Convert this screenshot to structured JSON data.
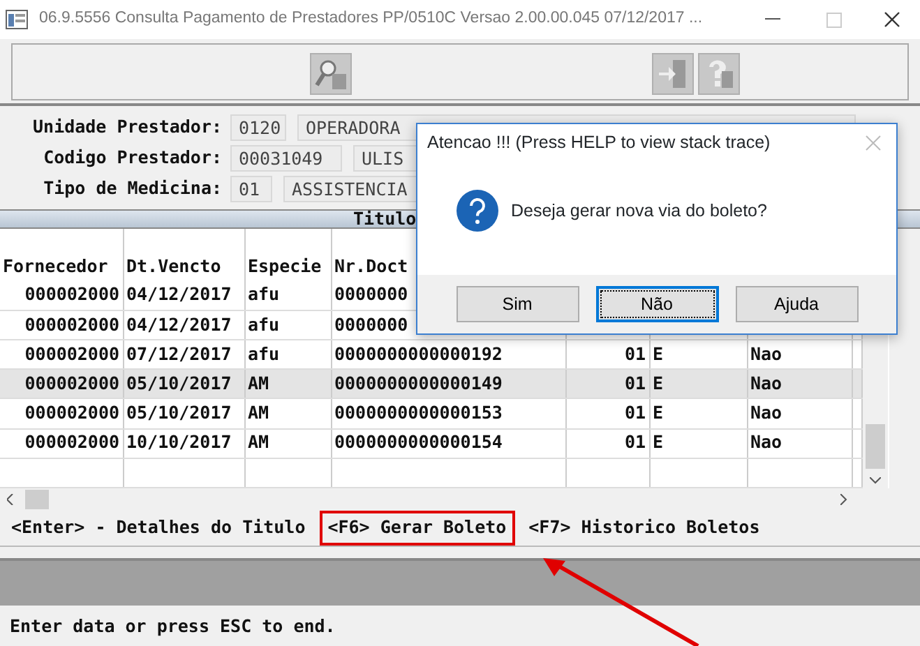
{
  "window": {
    "title": "06.9.5556  Consulta  Pagamento de Prestadores PP/0510C Versao 2.00.00.045 07/12/2017 ..."
  },
  "fields": [
    {
      "label": "Unidade Prestador:",
      "code": "0120",
      "value": "OPERADORA"
    },
    {
      "label": "Codigo Prestador:",
      "code": "00031049",
      "value": "ULIS"
    },
    {
      "label": "Tipo de Medicina:",
      "code": "01",
      "value": "ASSISTENCIA"
    }
  ],
  "table": {
    "title": "Titulo",
    "columns": [
      "Fornecedor",
      "Dt.Vencto",
      "Especie",
      "Nr.Doct"
    ],
    "rows": [
      {
        "selected": false,
        "cells": [
          "000002000",
          "04/12/2017",
          "afu",
          "0000000"
        ]
      },
      {
        "selected": false,
        "cells": [
          "000002000",
          "04/12/2017",
          "afu",
          "0000000"
        ]
      },
      {
        "selected": false,
        "cells": [
          "000002000",
          "07/12/2017",
          "afu",
          "0000000000000192",
          "01",
          "E",
          "Nao"
        ]
      },
      {
        "selected": true,
        "cells": [
          "000002000",
          "05/10/2017",
          "AM",
          "0000000000000149",
          "01",
          "E",
          "Nao"
        ]
      },
      {
        "selected": false,
        "cells": [
          "000002000",
          "05/10/2017",
          "AM",
          "0000000000000153",
          "01",
          "E",
          "Nao"
        ]
      },
      {
        "selected": false,
        "cells": [
          "000002000",
          "10/10/2017",
          "AM",
          "0000000000000154",
          "01",
          "E",
          "Nao"
        ]
      }
    ]
  },
  "hints": [
    {
      "text": "<Enter> - Detalhes do Titulo",
      "highlighted": false
    },
    {
      "text": "<F6> Gerar Boleto",
      "highlighted": true
    },
    {
      "text": "<F7> Historico Boletos",
      "highlighted": false
    }
  ],
  "status_bar": "Enter data or press ESC to end.",
  "dialog": {
    "title": "Atencao !!!  (Press HELP to view stack trace)",
    "message": "Deseja gerar nova via do boleto?",
    "buttons": [
      {
        "label": "Sim",
        "focused": false
      },
      {
        "label": "Não",
        "focused": true
      },
      {
        "label": "Ajuda",
        "focused": false
      }
    ]
  }
}
